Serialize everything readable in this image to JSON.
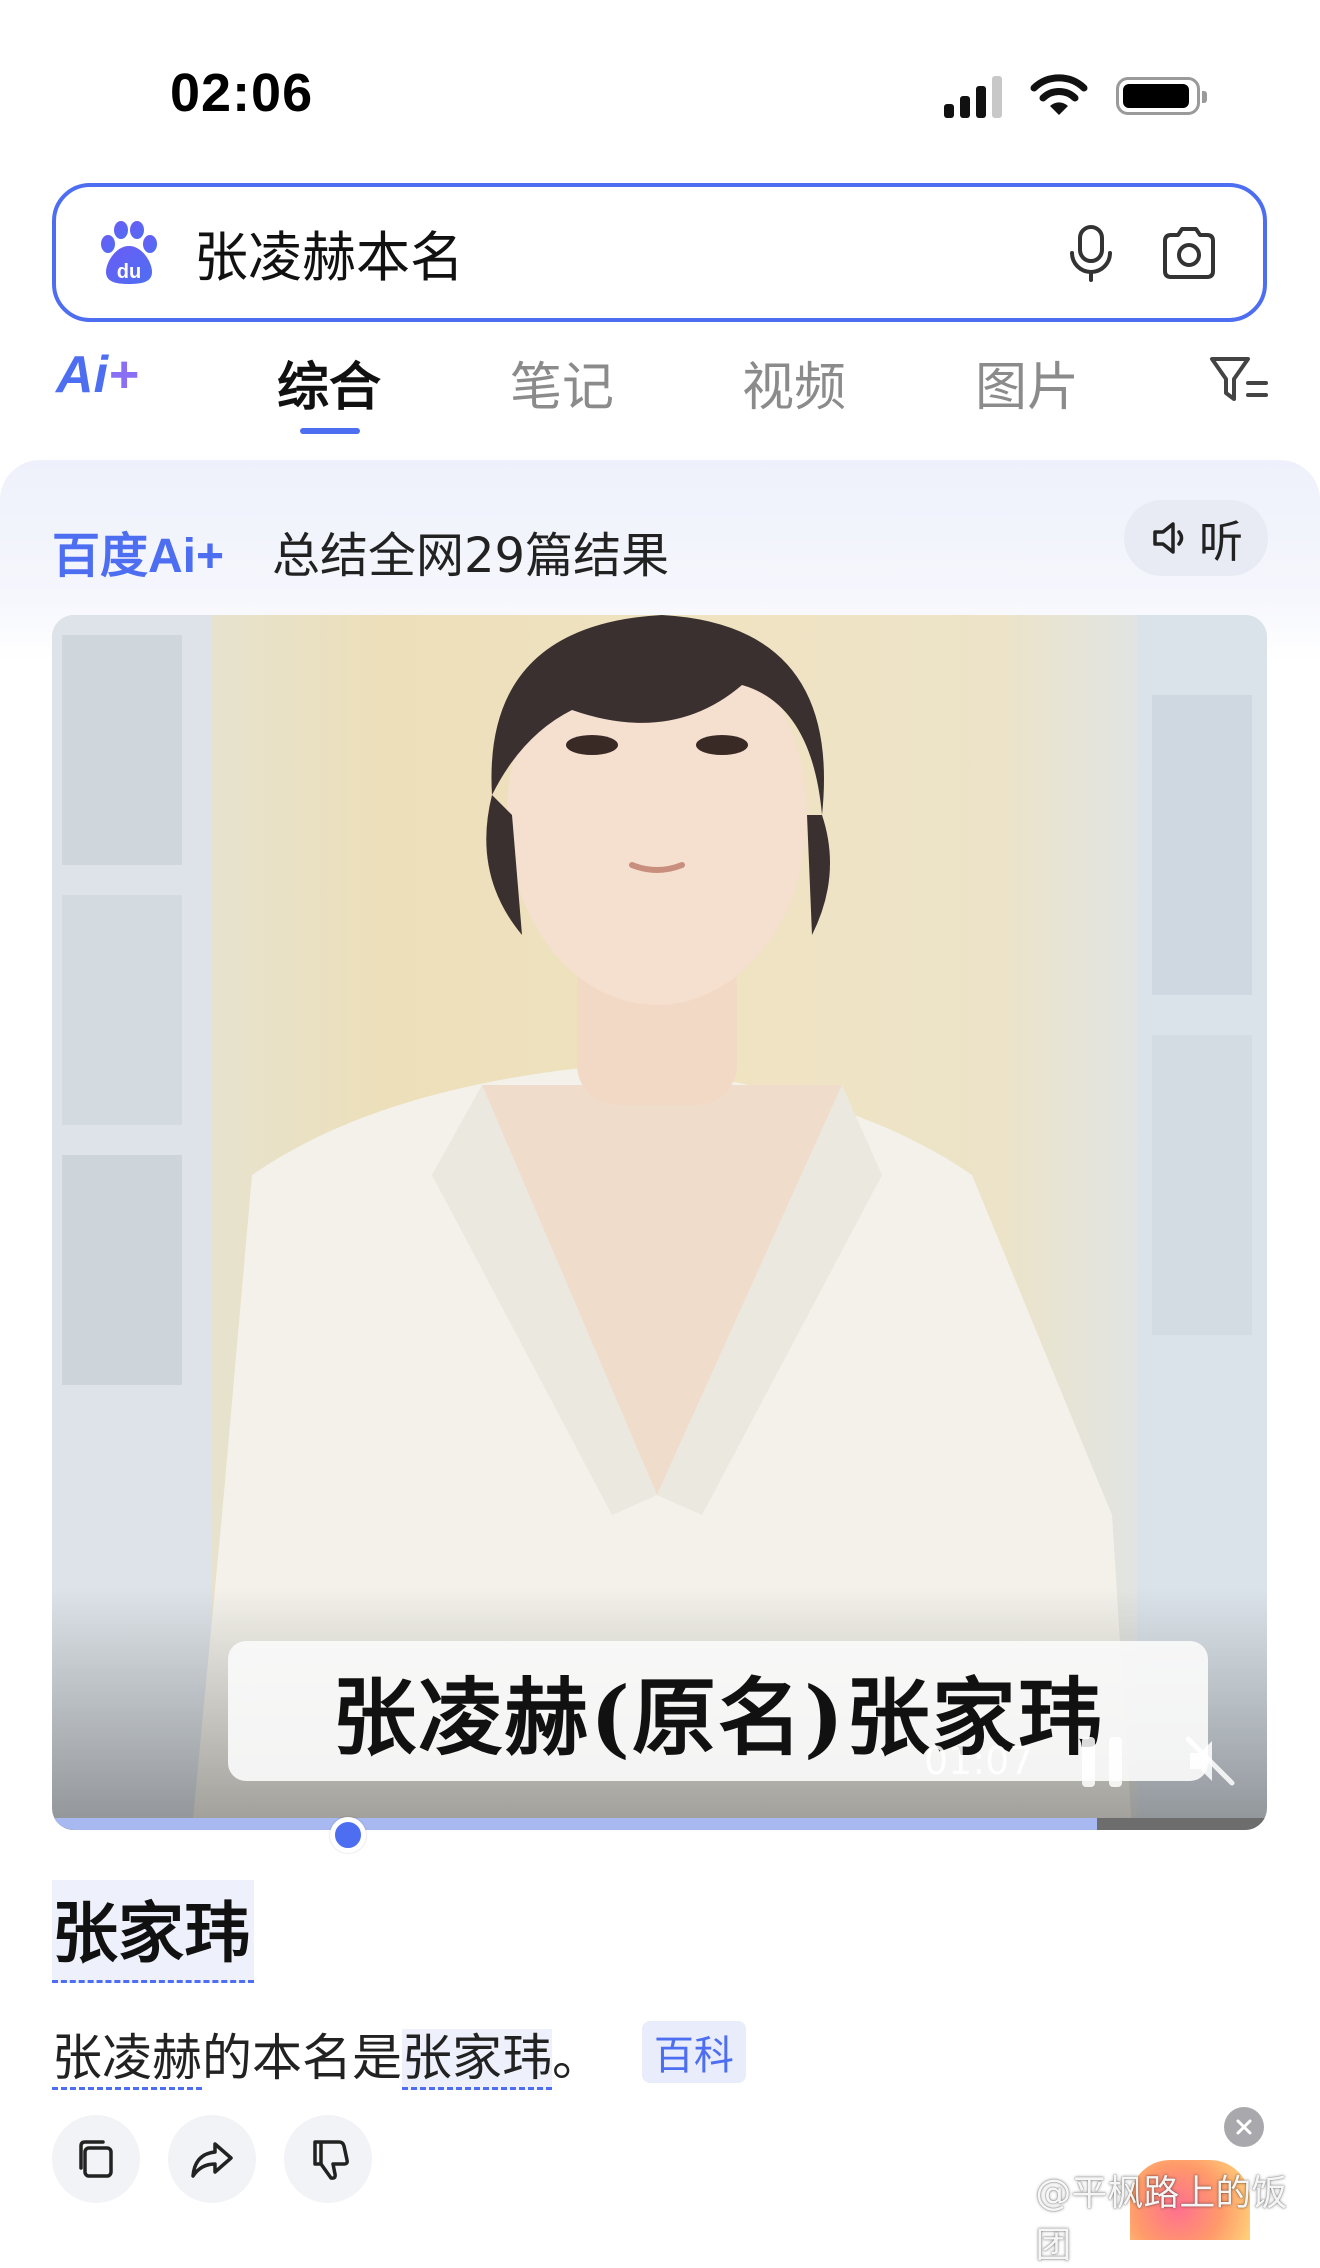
{
  "status_bar": {
    "time": "02:06"
  },
  "search": {
    "query": "张凌赫本名"
  },
  "tabs": {
    "ai": "Ai+",
    "items": [
      {
        "label": "综合",
        "active": true
      },
      {
        "label": "笔记",
        "active": false
      },
      {
        "label": "视频",
        "active": false
      },
      {
        "label": "图片",
        "active": false
      }
    ]
  },
  "ai_card": {
    "brand": "百度Ai+",
    "summary": "总结全网29篇结果",
    "listen": "听"
  },
  "video": {
    "caption": "张凌赫(原名)张家玮",
    "time": "01:07",
    "progress": 0.86
  },
  "answer": {
    "title": "张家玮",
    "body_pre": "张凌赫",
    "body_mid": "的本名是",
    "body_name": "张家玮",
    "body_end": "。",
    "source": "百科"
  },
  "watermark": "@平枫路上的饭团",
  "colors": {
    "accent": "#4e6ef2",
    "card_bg": "#eef1fb"
  }
}
